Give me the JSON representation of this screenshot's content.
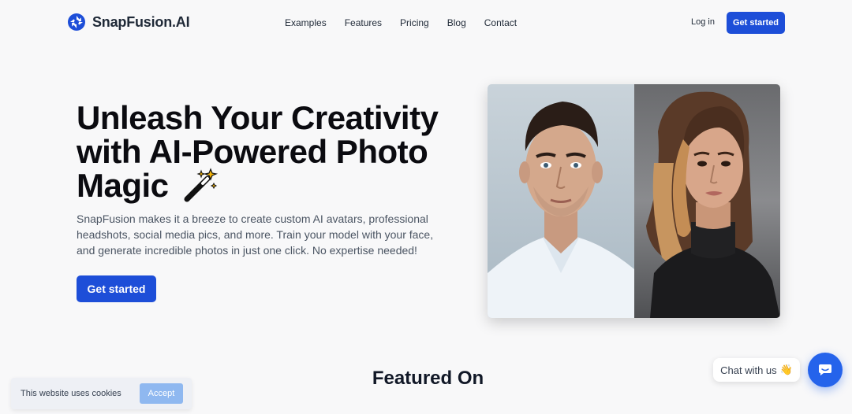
{
  "header": {
    "brand": "SnapFusion.AI",
    "nav": [
      "Examples",
      "Features",
      "Pricing",
      "Blog",
      "Contact"
    ],
    "login": "Log in",
    "cta": "Get started"
  },
  "hero": {
    "title_line1": "Unleash Your Creativity",
    "title_line2": "with AI-Powered Photo",
    "title_line3": "Magic",
    "description": "SnapFusion makes it a breeze to create custom AI avatars, professional headshots, social media pics, and more. Train your model with your face, and generate incredible photos in just one click. No expertise needed!",
    "cta": "Get started"
  },
  "featured": {
    "title": "Featured On"
  },
  "cookie": {
    "text": "This website uses cookies",
    "button": "Accept"
  },
  "chat": {
    "label": "Chat with us",
    "emoji": "👋"
  },
  "colors": {
    "primary": "#1d4ed8",
    "background": "#f8f8f9"
  }
}
